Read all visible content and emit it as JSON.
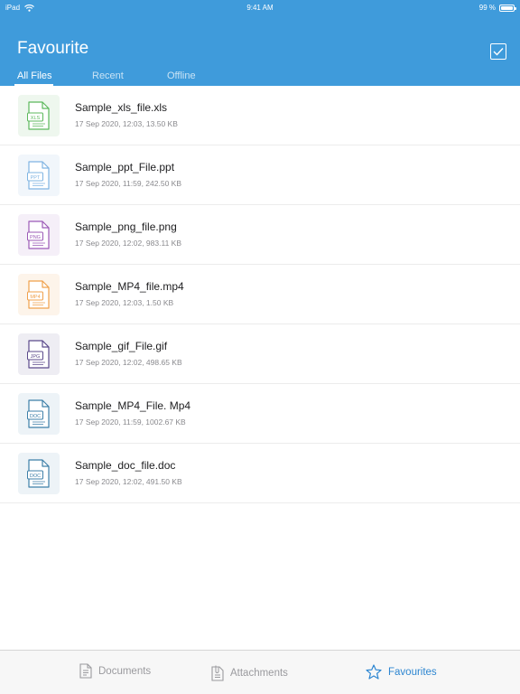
{
  "status_bar": {
    "device": "iPad",
    "time": "9:41 AM",
    "battery": "99 %",
    "battery_level": 0.99
  },
  "header": {
    "title": "Favourite"
  },
  "tabs": [
    {
      "label": "All Files",
      "active": true
    },
    {
      "label": "Recent",
      "active": false
    },
    {
      "label": "Offline",
      "active": false
    }
  ],
  "files": [
    {
      "name": "Sample_xls_file.xls",
      "meta": "17 Sep 2020, 12:03, 13.50 KB",
      "badge": "XLS",
      "icon": "xls-file-icon",
      "color": "#5cb85c",
      "bg": "#eef7ee"
    },
    {
      "name": "Sample_ppt_File.ppt",
      "meta": "17 Sep 2020, 11:59, 242.50 KB",
      "badge": "PPT",
      "icon": "ppt-file-icon",
      "color": "#7fb4e2",
      "bg": "#f1f6fb"
    },
    {
      "name": "Sample_png_file.png",
      "meta": "17 Sep 2020, 12:02, 983.11 KB",
      "badge": "PNG",
      "icon": "png-file-icon",
      "color": "#9b59b6",
      "bg": "#f5eff8"
    },
    {
      "name": "Sample_MP4_file.mp4",
      "meta": "17 Sep 2020, 12:03, 1.50 KB",
      "badge": "MP4",
      "icon": "mp4-file-icon",
      "color": "#f0a04b",
      "bg": "#fdf4ea"
    },
    {
      "name": "Sample_gif_File.gif",
      "meta": "17 Sep 2020, 12:02, 498.65 KB",
      "badge": "JPG",
      "icon": "jpg-file-icon",
      "color": "#5b4a8b",
      "bg": "#eeedf3"
    },
    {
      "name": "Sample_MP4_File. Mp4",
      "meta": "17 Sep 2020, 11:59, 1002.67 KB",
      "badge": "DOC",
      "icon": "doc-file-icon",
      "color": "#3d7fa8",
      "bg": "#edf3f7"
    },
    {
      "name": "Sample_doc_file.doc",
      "meta": "17 Sep 2020, 12:02, 491.50 KB",
      "badge": "DOC",
      "icon": "doc-file-icon",
      "color": "#3d7fa8",
      "bg": "#edf3f7"
    }
  ],
  "tabbar": [
    {
      "label": "Documents",
      "icon": "document-icon",
      "active": false
    },
    {
      "label": "Attachments",
      "icon": "attachment-icon",
      "active": false
    },
    {
      "label": "Favourites",
      "icon": "star-icon",
      "active": true
    }
  ],
  "colors": {
    "header": "#3f9bdb",
    "accent": "#2d86d1",
    "inactive": "#9a9a9e"
  }
}
